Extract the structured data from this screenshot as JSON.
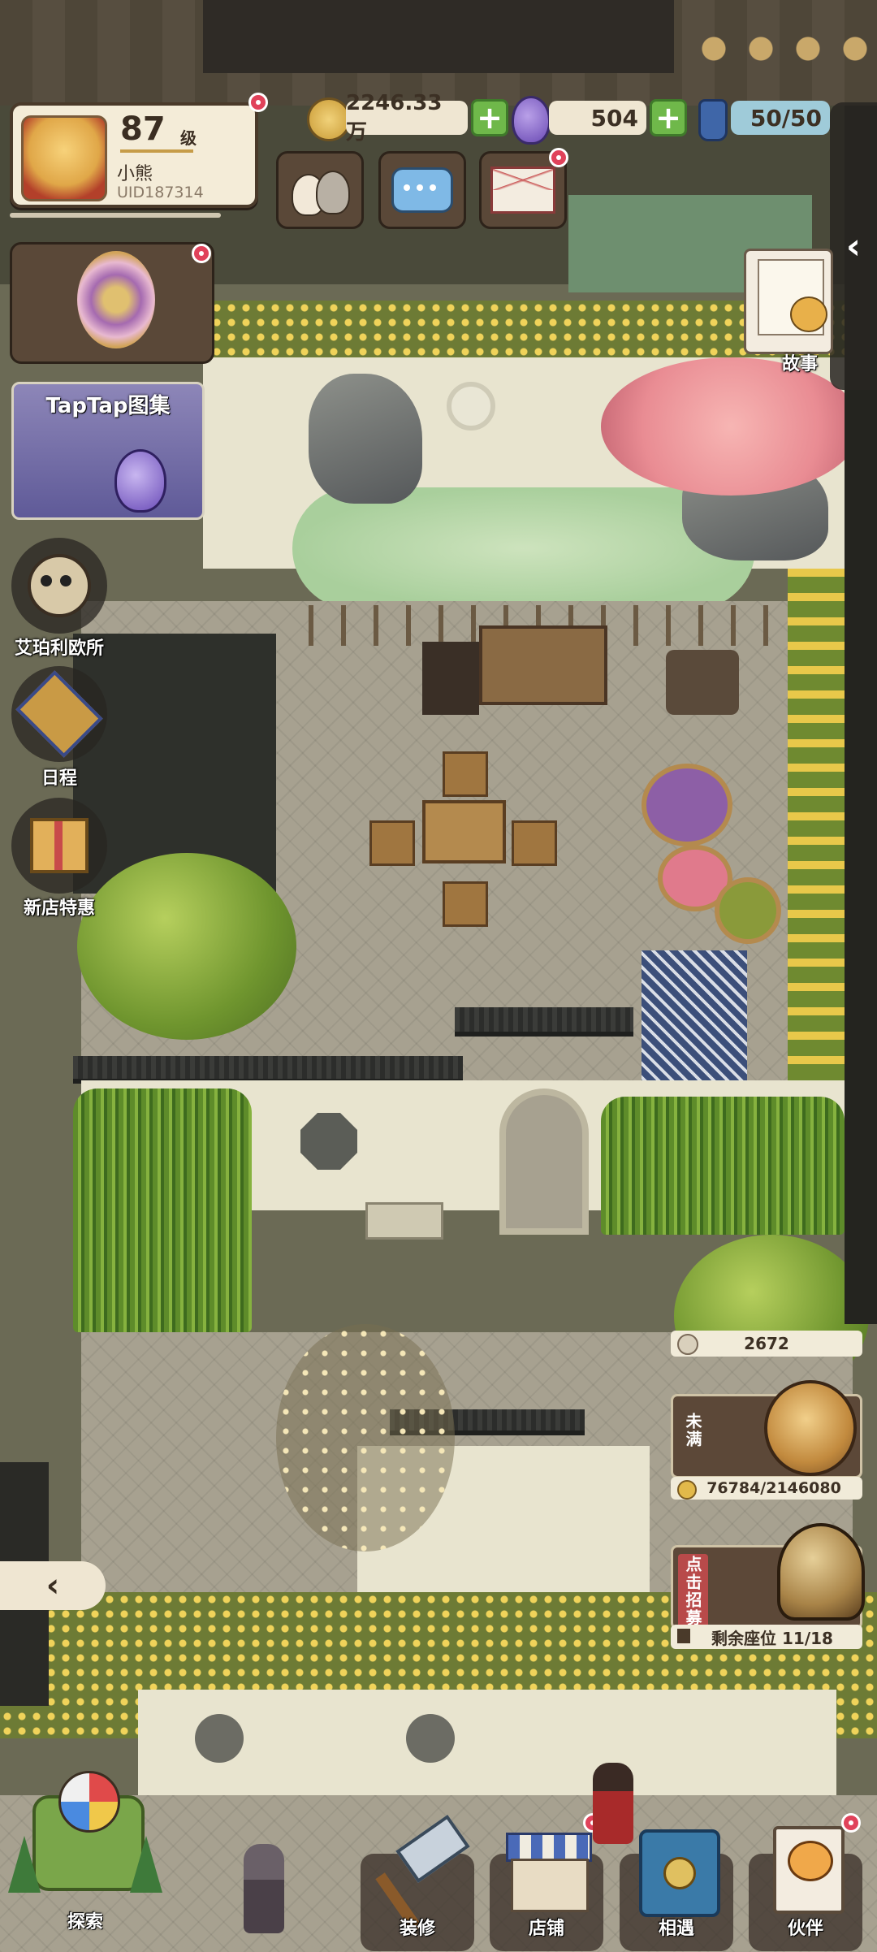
{
  "player": {
    "level_number": "87",
    "level_suffix": "级",
    "name": "小熊",
    "uid": "UID187314"
  },
  "resources": {
    "coins": "2246.33万",
    "eggs": "504",
    "stamina": "50/50"
  },
  "top_icons": {
    "cats": "cats-icon",
    "chat": "chat-icon",
    "mail": "mail-icon"
  },
  "left_menu": {
    "banner_icon": "tree-emblem-icon",
    "taptap_label": "TapTap图集",
    "items": [
      {
        "label": "艾珀利欧所",
        "icon": "owl-icon"
      },
      {
        "label": "日程",
        "icon": "schedule-icon"
      },
      {
        "label": "新店特惠",
        "icon": "gift-icon"
      }
    ]
  },
  "right_menu": {
    "story_label": "故事",
    "collapse_icon": "chevron-left-icon"
  },
  "shop_status": {
    "count": "2672",
    "not_full_label": "未满",
    "progress_text": "76784/2146080",
    "progress_fraction": 0.0358,
    "recruit_label": "点击招募",
    "seats_text": "剩余座位 11/18"
  },
  "bottom_nav": [
    {
      "label": "探索",
      "icon": "pinwheel-icon"
    },
    {
      "label": "装修",
      "icon": "hammer-icon"
    },
    {
      "label": "店铺",
      "icon": "shop-icon"
    },
    {
      "label": "相遇",
      "icon": "encounter-icon"
    },
    {
      "label": "伙伴",
      "icon": "partner-icon"
    }
  ],
  "colors": {
    "accent_green": "#6fb84a",
    "badge_red": "#e0425a",
    "panel_cream": "#f4ecd8",
    "panel_brown": "#5c4838",
    "stamina_blue": "#9fcbd9"
  }
}
